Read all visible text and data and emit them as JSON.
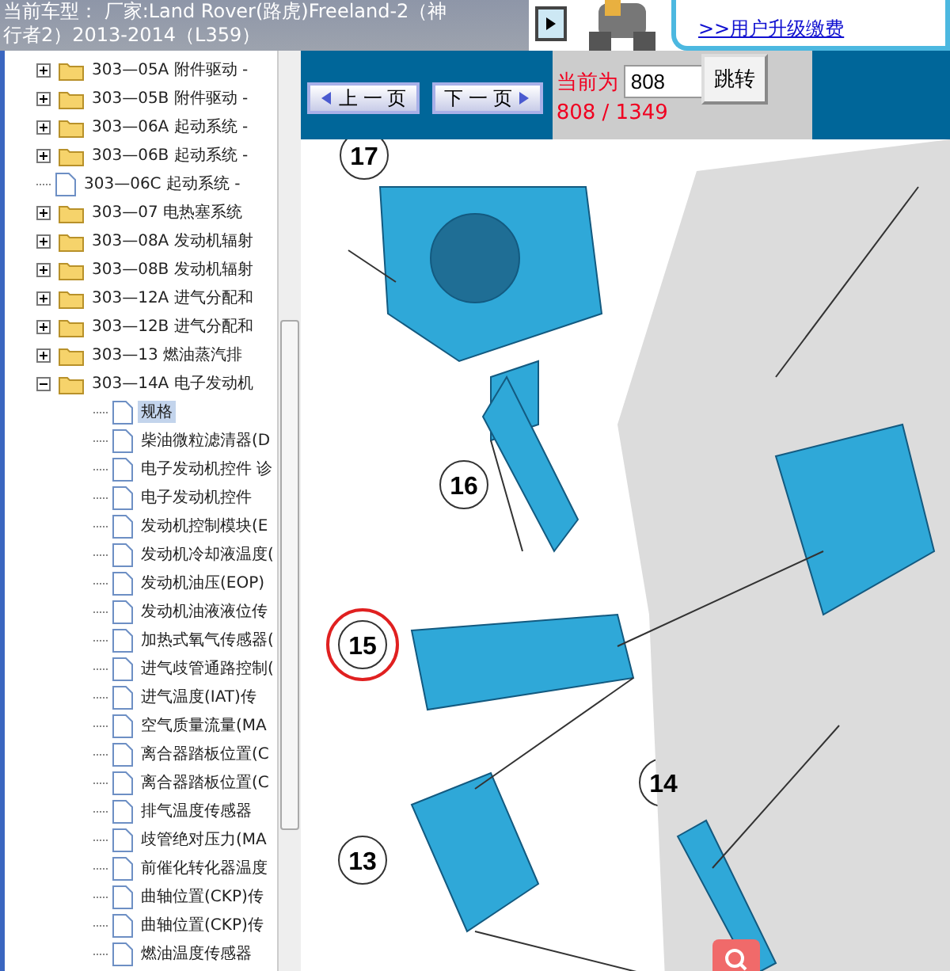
{
  "header": {
    "line1": "当前车型： 厂家:Land Rover(路虎)Freeland-2（神",
    "line2": "行者2）2013-2014（L359）"
  },
  "ad": {
    "link": ">>用户升级缴费"
  },
  "tree": [
    {
      "label": "303—05A 附件驱动 -",
      "kind": "folder",
      "expanded": false,
      "selected": false
    },
    {
      "label": "303—05B 附件驱动 -",
      "kind": "folder",
      "expanded": false,
      "selected": false
    },
    {
      "label": "303—06A 起动系统 -",
      "kind": "folder",
      "expanded": false,
      "selected": false
    },
    {
      "label": "303—06B 起动系统 -",
      "kind": "folder",
      "expanded": false,
      "selected": false
    },
    {
      "label": "303—06C 起动系统 -",
      "kind": "page",
      "selected": false
    },
    {
      "label": "303—07 电热塞系统",
      "kind": "folder",
      "expanded": false,
      "selected": false
    },
    {
      "label": "303—08A 发动机辐射",
      "kind": "folder",
      "expanded": false,
      "selected": false
    },
    {
      "label": "303—08B 发动机辐射",
      "kind": "folder",
      "expanded": false,
      "selected": false
    },
    {
      "label": "303—12A 进气分配和",
      "kind": "folder",
      "expanded": false,
      "selected": false
    },
    {
      "label": "303—12B 进气分配和",
      "kind": "folder",
      "expanded": false,
      "selected": false
    },
    {
      "label": "303—13 燃油蒸汽排",
      "kind": "folder",
      "expanded": false,
      "selected": false
    },
    {
      "label": "303—14A 电子发动机",
      "kind": "folder",
      "expanded": true,
      "selected": false,
      "children": [
        {
          "label": "规格",
          "kind": "page",
          "selected": true
        },
        {
          "label": "柴油微粒滤清器(D",
          "kind": "page",
          "selected": false
        },
        {
          "label": "电子发动机控件 诊",
          "kind": "page",
          "selected": false
        },
        {
          "label": "电子发动机控件",
          "kind": "page",
          "selected": false
        },
        {
          "label": "发动机控制模块(E",
          "kind": "page",
          "selected": false
        },
        {
          "label": "发动机冷却液温度(",
          "kind": "page",
          "selected": false
        },
        {
          "label": "发动机油压(EOP)",
          "kind": "page",
          "selected": false
        },
        {
          "label": "发动机油液液位传",
          "kind": "page",
          "selected": false
        },
        {
          "label": "加热式氧气传感器(",
          "kind": "page",
          "selected": false
        },
        {
          "label": "进气歧管通路控制(",
          "kind": "page",
          "selected": false
        },
        {
          "label": "进气温度(IAT)传",
          "kind": "page",
          "selected": false
        },
        {
          "label": "空气质量流量(MA",
          "kind": "page",
          "selected": false
        },
        {
          "label": "离合器踏板位置(C",
          "kind": "page",
          "selected": false
        },
        {
          "label": "离合器踏板位置(C",
          "kind": "page",
          "selected": false
        },
        {
          "label": "排气温度传感器",
          "kind": "page",
          "selected": false
        },
        {
          "label": "歧管绝对压力(MA",
          "kind": "page",
          "selected": false
        },
        {
          "label": "前催化转化器温度",
          "kind": "page",
          "selected": false
        },
        {
          "label": "曲轴位置(CKP)传",
          "kind": "page",
          "selected": false
        },
        {
          "label": "曲轴位置(CKP)传",
          "kind": "page",
          "selected": false
        },
        {
          "label": "燃油温度传感器",
          "kind": "page",
          "selected": false
        }
      ]
    }
  ],
  "pager": {
    "prev": "上 一 页",
    "next": "下 一 页",
    "current_label": "当前为",
    "page_value": "808",
    "go": "跳转",
    "position": "808 / 1349"
  },
  "diagram": {
    "callouts": [
      {
        "label": "17",
        "highlighted": false
      },
      {
        "label": "16",
        "highlighted": false
      },
      {
        "label": "15",
        "highlighted": true
      },
      {
        "label": "14",
        "highlighted": false
      },
      {
        "label": "13",
        "highlighted": false
      }
    ]
  }
}
